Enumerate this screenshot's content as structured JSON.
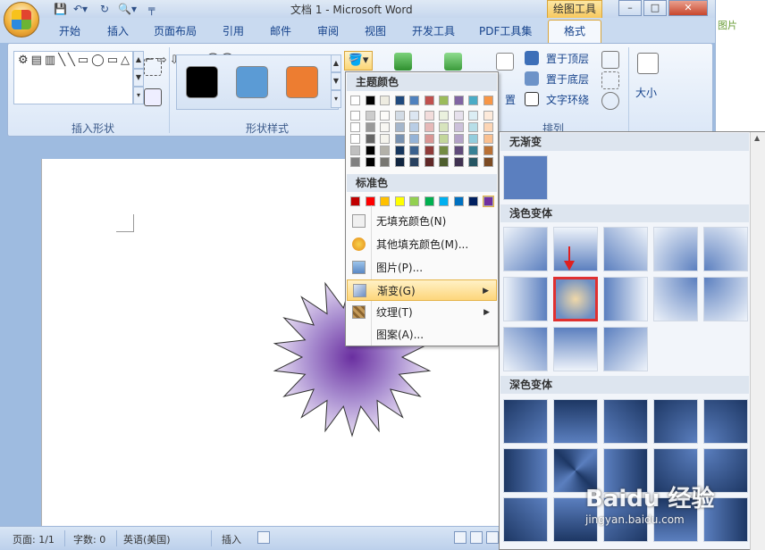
{
  "title": {
    "doc": "文档 1 - Microsoft Word",
    "context_tab": "绘图工具"
  },
  "window_controls": {
    "min": "–",
    "max": "□",
    "close": "✕"
  },
  "tabs": [
    "开始",
    "插入",
    "页面布局",
    "引用",
    "邮件",
    "审阅",
    "视图",
    "开发工具",
    "PDF工具集",
    "格式"
  ],
  "ribbon": {
    "insert_shapes_label": "插入形状",
    "shape_styles_label": "形状样式",
    "arrange_label": "排列",
    "bring_front": "置于顶层",
    "send_back": "置于底层",
    "text_wrap": "文字环绕",
    "size": "大小",
    "position_partial": "置",
    "shapes_glyphs": "⚙▤▥╲╲▭◯▭△⌐⌐⇨⇩◔∿⌒⌒{",
    "style_colors": [
      "#000000",
      "#5b9bd5",
      "#ed7d31"
    ]
  },
  "right_strip": {
    "text": "图片"
  },
  "fill_menu": {
    "theme_header": "主题颜色",
    "theme_colors": [
      "#ffffff",
      "#000000",
      "#eeece1",
      "#1f497d",
      "#4f81bd",
      "#c0504d",
      "#9bbb59",
      "#8064a2",
      "#4bacc6",
      "#f79646"
    ],
    "standard_header": "标准色",
    "standard_colors": [
      "#c00000",
      "#ff0000",
      "#ffc000",
      "#ffff00",
      "#92d050",
      "#00b050",
      "#00b0f0",
      "#0070c0",
      "#002060",
      "#7030a0"
    ],
    "items": [
      {
        "label": "无填充颜色(N)",
        "icon": "no-fill-icon"
      },
      {
        "label": "其他填充颜色(M)...",
        "icon": "palette-icon"
      },
      {
        "label": "图片(P)...",
        "icon": "picture-icon"
      },
      {
        "label": "渐变(G)",
        "icon": "gradient-icon",
        "submenu": true,
        "highlighted": true
      },
      {
        "label": "纹理(T)",
        "icon": "texture-icon",
        "submenu": true
      },
      {
        "label": "图案(A)...",
        "icon": "pattern-icon"
      }
    ]
  },
  "gradient_panel": {
    "no_gradient": "无渐变",
    "light_variants": "浅色变体",
    "dark_variants": "深色变体",
    "base_color": "#5b7fbf",
    "selected_index": 6
  },
  "statusbar": {
    "page": "页面: 1/1",
    "words": "字数: 0",
    "language": "英语(美国)",
    "mode": "插入"
  },
  "watermark": {
    "main": "Baidu 经验",
    "sub": "jingyan.baidu.com"
  }
}
